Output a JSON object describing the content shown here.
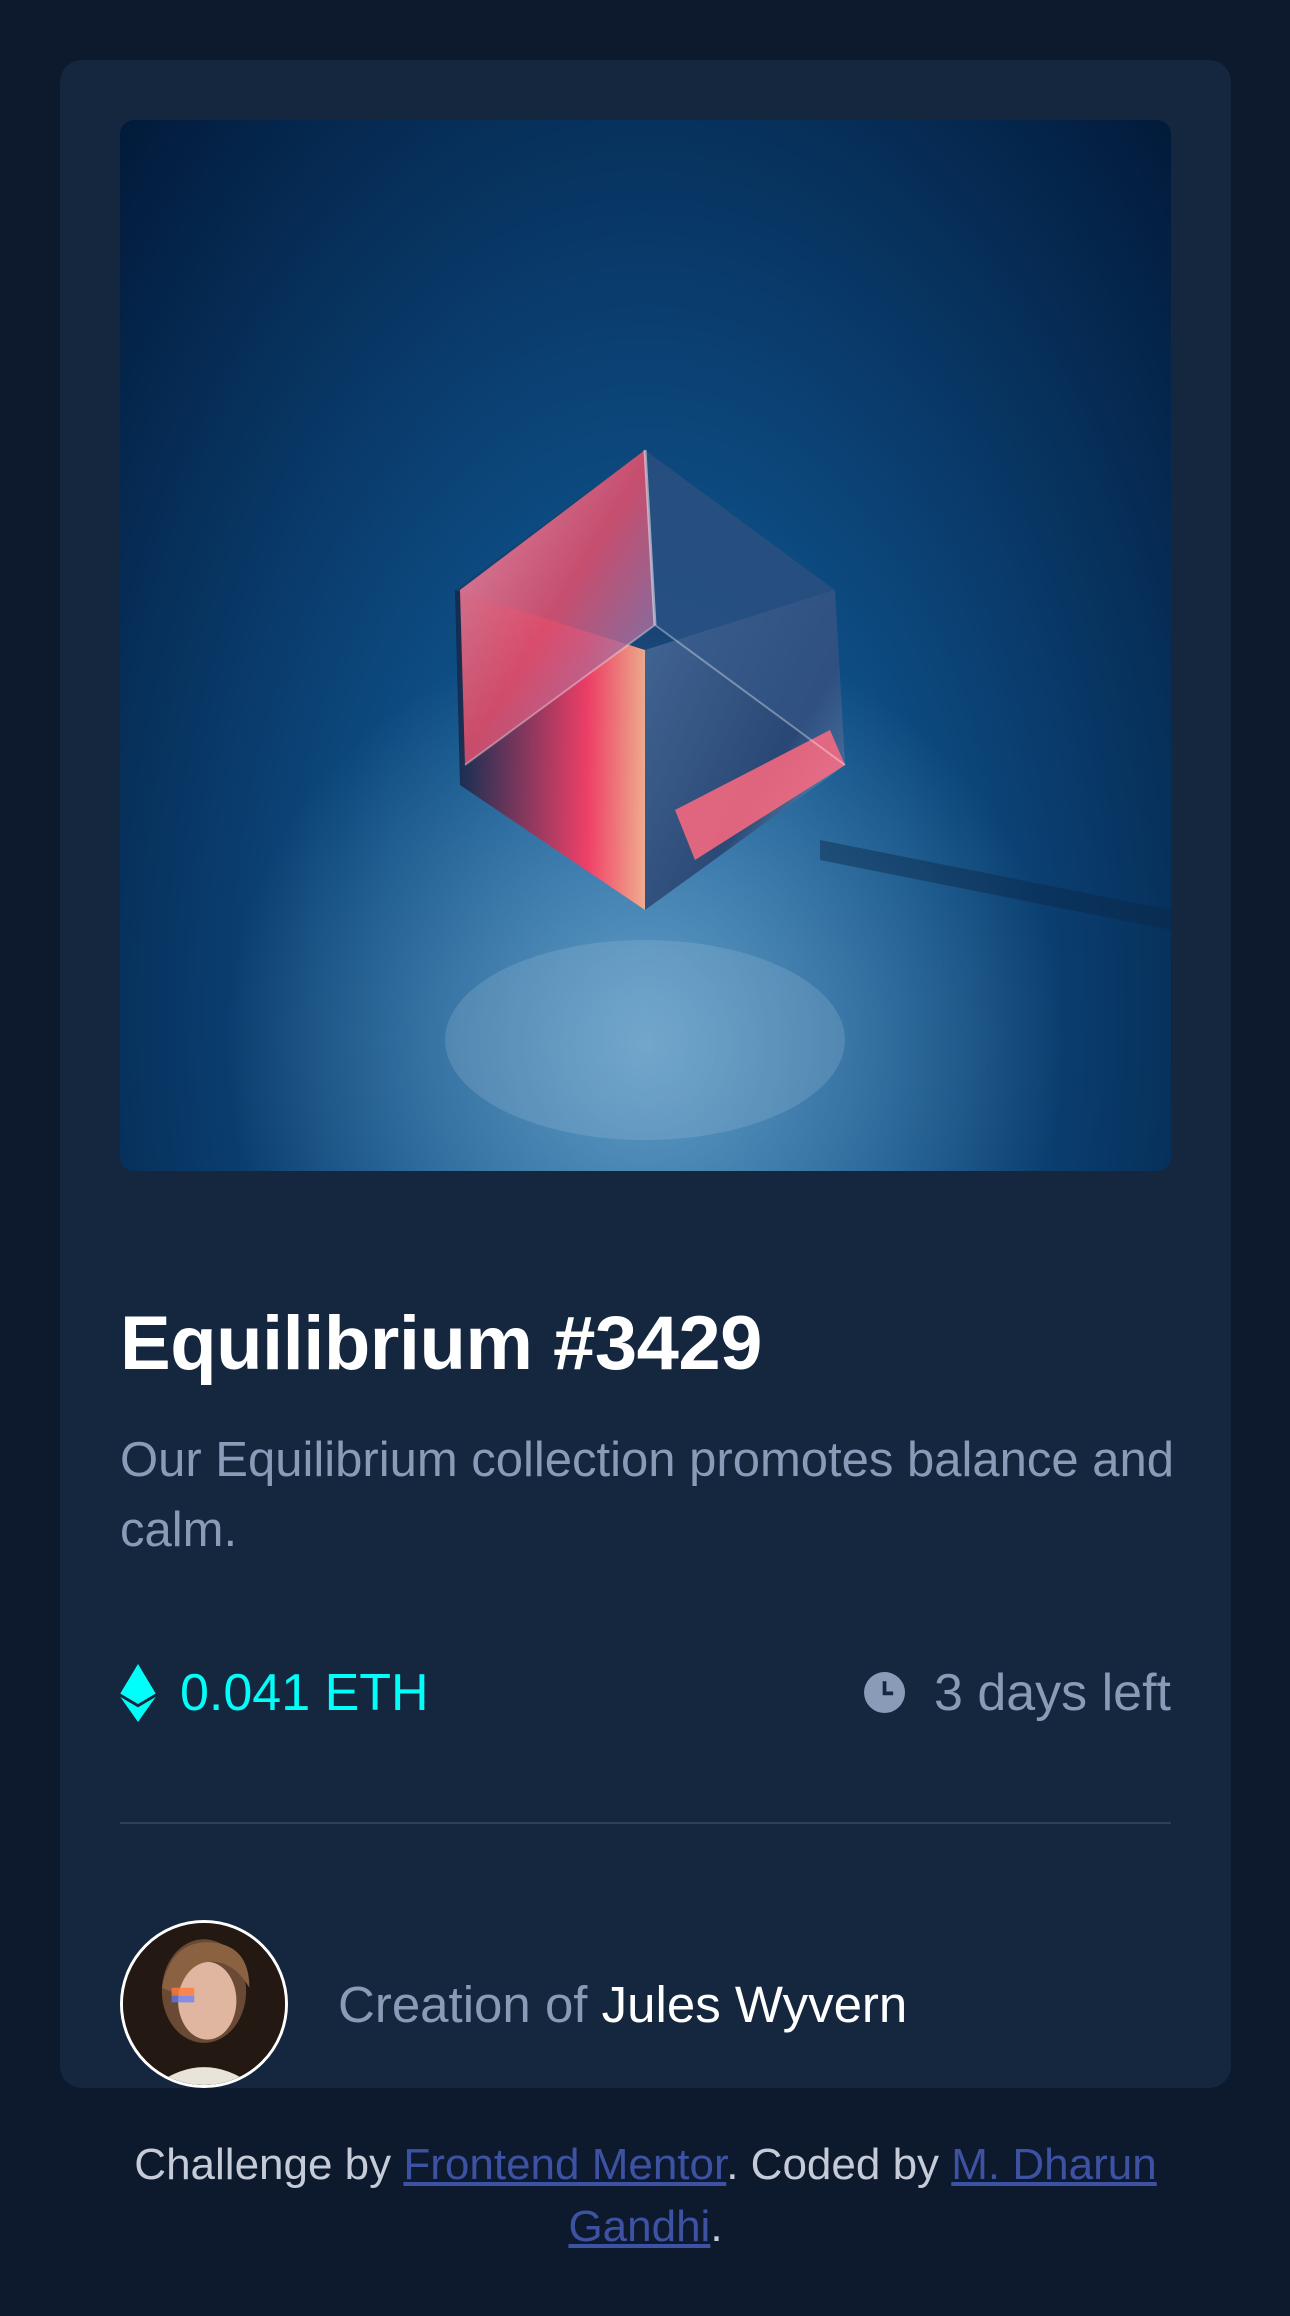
{
  "card": {
    "image_alt": "Equilibrium cube",
    "title": "Equilibrium #3429",
    "description": "Our Equilibrium collection promotes balance and calm.",
    "price": {
      "icon": "ethereum-icon",
      "value": "0.041 ETH"
    },
    "time": {
      "icon": "clock-icon",
      "value": "3 days left"
    },
    "creator": {
      "avatar_alt": "Jules Wyvern",
      "prefix": "Creation of ",
      "name": "Jules Wyvern"
    }
  },
  "attribution": {
    "prefix": "Challenge by ",
    "link1": "Frontend Mentor",
    "middle": ". Coded by ",
    "link2": "M. Dharun Gandhi",
    "suffix": "."
  },
  "colors": {
    "page_bg": "#0d1a2e",
    "card_bg": "#15263f",
    "cyan": "#00fff8",
    "soft_blue": "#8a9bb7",
    "white": "#ffffff",
    "link": "#3e52a3"
  }
}
